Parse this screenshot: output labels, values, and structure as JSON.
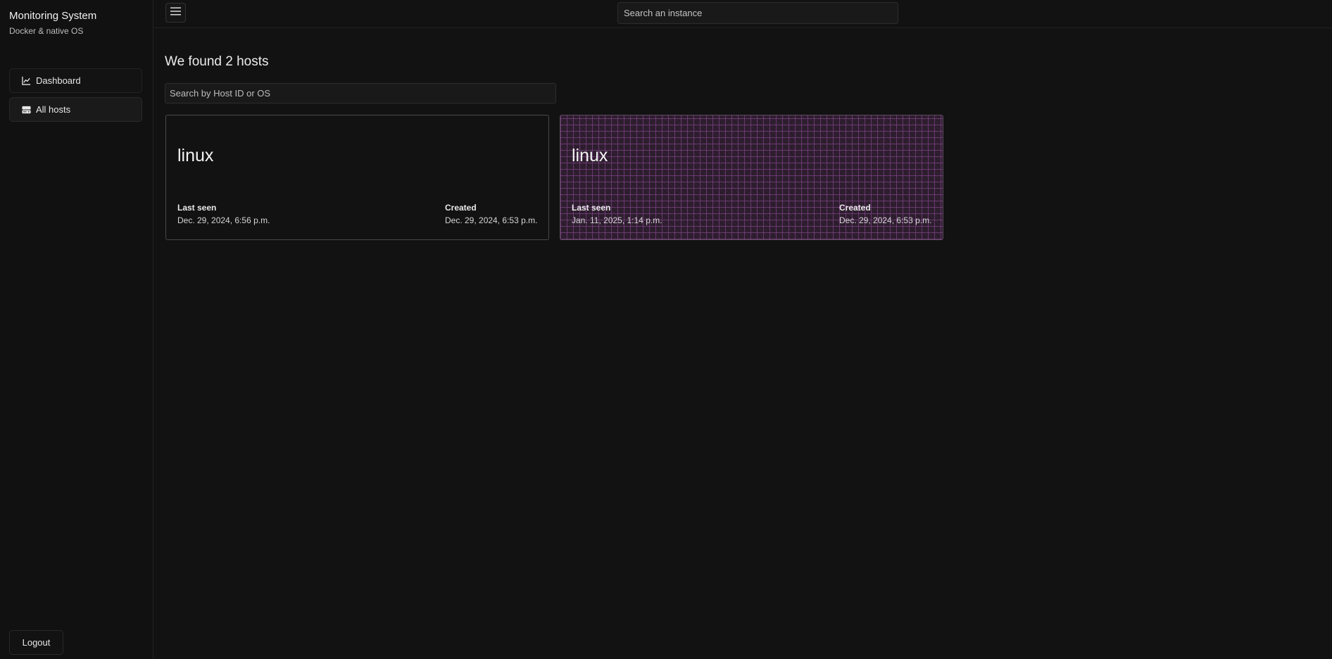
{
  "sidebar": {
    "title": "Monitoring System",
    "subtitle": "Docker & native OS",
    "items": [
      {
        "label": "Dashboard",
        "icon": "chart-line-icon"
      },
      {
        "label": "All hosts",
        "icon": "server-icon"
      }
    ],
    "logout_label": "Logout"
  },
  "topbar": {
    "menu_icon": "hamburger-menu-icon",
    "search_placeholder": "Search an instance"
  },
  "main": {
    "title": "We found 2 hosts",
    "search_placeholder": "Search by Host ID or OS",
    "hosts": [
      {
        "os": "linux",
        "last_seen_label": "Last seen",
        "last_seen": "Dec. 29, 2024, 6:56 p.m.",
        "created_label": "Created",
        "created": "Dec. 29, 2024, 6:53 p.m."
      },
      {
        "os": "linux",
        "last_seen_label": "Last seen",
        "last_seen": "Jan. 11, 2025, 1:14 p.m.",
        "created_label": "Created",
        "created": "Dec. 29, 2024, 6:53 p.m."
      }
    ]
  },
  "colors": {
    "background": "#131213",
    "highlight_card": "#2a1d2b",
    "pattern_accent": "#9650a0"
  }
}
